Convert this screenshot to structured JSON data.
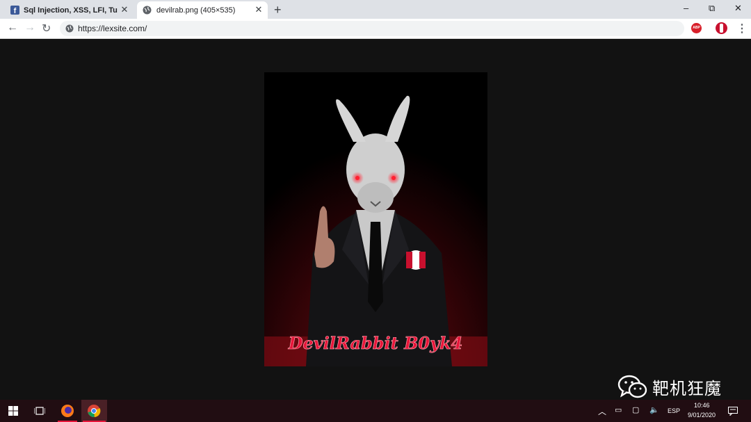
{
  "tabs": [
    {
      "title": "Sql Injection, XSS, LFI, Tutorials",
      "icon": "facebook-icon",
      "active": false
    },
    {
      "title": "devilrab.png (405×535)",
      "icon": "globe-icon",
      "active": true
    }
  ],
  "window_controls": {
    "minimize": "–",
    "restore": "⧉",
    "close": "✕"
  },
  "toolbar": {
    "url": "https://lexsite.com/",
    "extension_abp": "ABP"
  },
  "image": {
    "caption": "DevilRabbit B0yk4"
  },
  "taskbar": {
    "language": "ESP",
    "time": "10:46",
    "date": "9/01/2020"
  },
  "watermark": {
    "text": "靶机狂魔"
  },
  "colors": {
    "accent_red": "#e8163a",
    "taskbar_bg": "#210d12",
    "page_bg": "#121212"
  }
}
